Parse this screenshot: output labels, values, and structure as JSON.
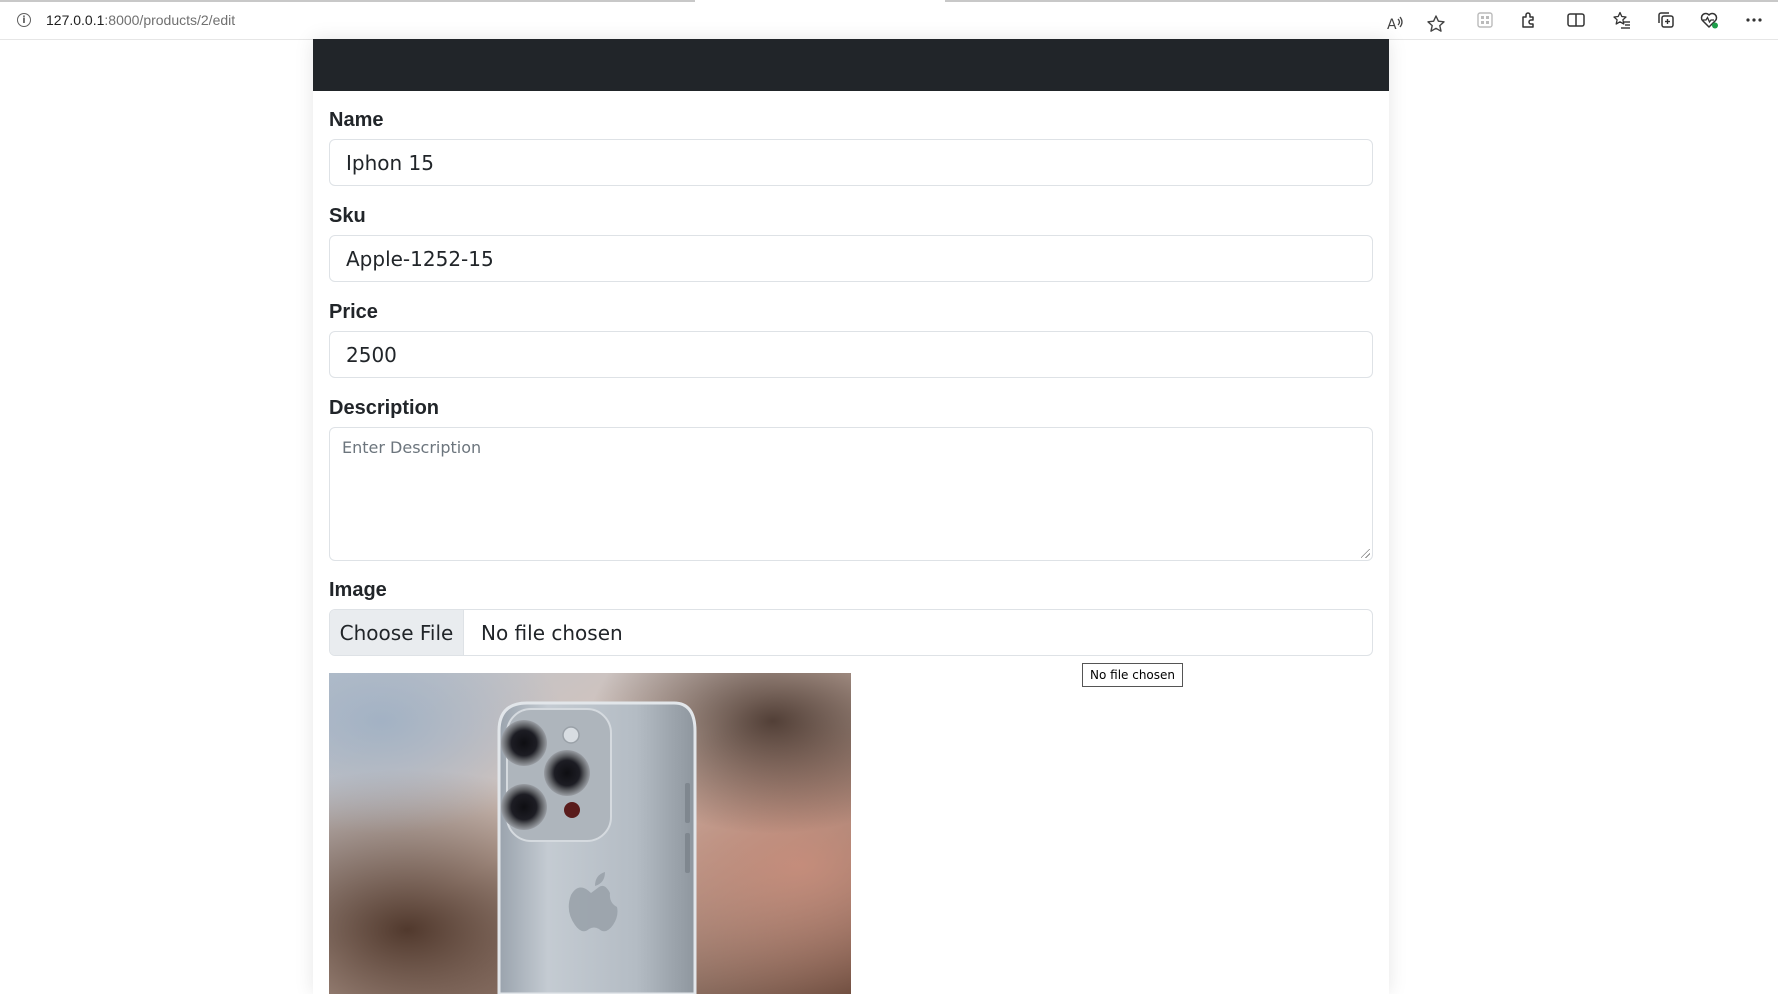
{
  "browser": {
    "url_host": "127.0.0.1",
    "url_path": ":8000/products/2/edit"
  },
  "form": {
    "name": {
      "label": "Name",
      "value": "Iphon 15"
    },
    "sku": {
      "label": "Sku",
      "value": "Apple-1252-15"
    },
    "price": {
      "label": "Price",
      "value": "2500"
    },
    "description": {
      "label": "Description",
      "value": "",
      "placeholder": "Enter Description"
    },
    "image": {
      "label": "Image",
      "button_label": "Choose File",
      "status": "No file chosen"
    }
  },
  "tooltip": {
    "text": "No file chosen"
  },
  "icons": {
    "site_info": "info-icon",
    "read_aloud": "read-aloud-icon",
    "favorite": "star-icon",
    "extensions": "puzzle-icon",
    "split_screen": "split-screen-icon",
    "favorites": "favorites-icon",
    "collections": "collections-icon",
    "browser_essentials": "heart-pulse-icon",
    "more": "more-icon"
  },
  "colors": {
    "navbar": "#212529",
    "border": "#dee2e6",
    "file_button_bg": "#e9ecef"
  }
}
